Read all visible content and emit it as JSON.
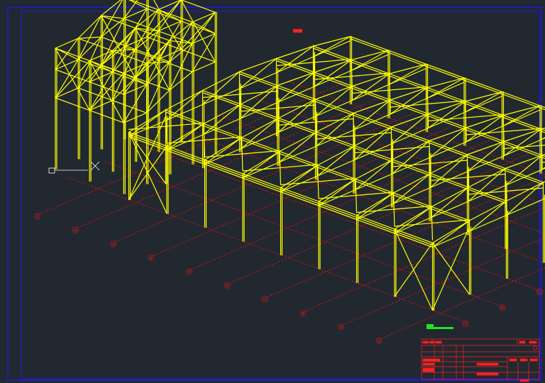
{
  "colors": {
    "background": "#212830",
    "border": "#1e1eb4",
    "steel": "#ffff00",
    "steel_dark": "#c8c800",
    "axis": "#e01010",
    "title_block": "#ff2020",
    "scale_bar": "#1ee61e",
    "cursor": "#ffffff"
  },
  "grid_axes_left": [
    "①",
    "②",
    "③",
    "④",
    "⑤",
    "⑥",
    "⑦",
    "⑧",
    "⑨",
    "⑩"
  ],
  "grid_axes_right": [
    "Ⓐ",
    "Ⓑ",
    "Ⓒ",
    "Ⓓ",
    "Ⓔ",
    "Ⓕ",
    "Ⓖ"
  ],
  "drawing": {
    "view": "isometric",
    "subject": "steel-frame",
    "cursor": "crosshair"
  }
}
